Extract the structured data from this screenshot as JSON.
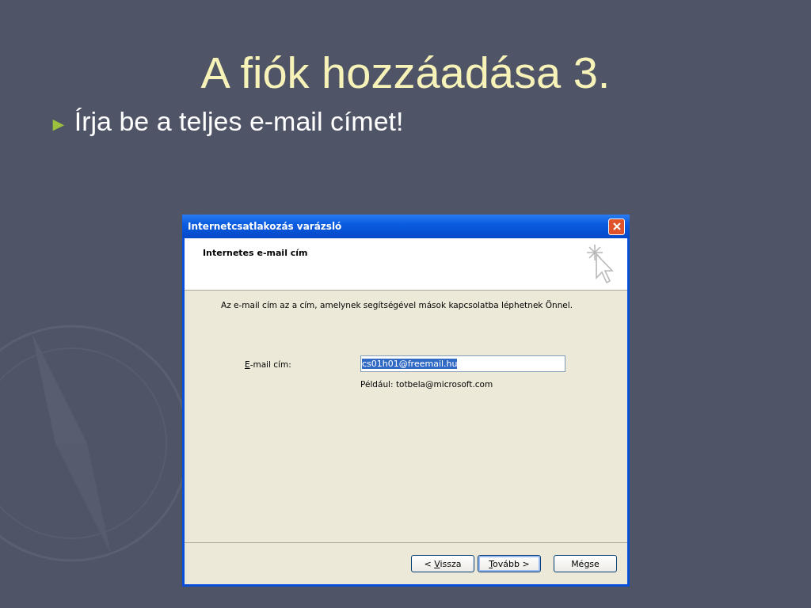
{
  "slide": {
    "title": "A fiók hozzáadása 3.",
    "bullets": [
      {
        "marker": "►",
        "text": "Írja be a teljes e-mail címet!"
      }
    ]
  },
  "dialog": {
    "title": "Internetcsatlakozás varázsló",
    "header": "Internetes e-mail cím",
    "description": "Az e-mail cím az a cím, amelynek segítségével mások kapcsolatba léphetnek Önnel.",
    "field": {
      "label": {
        "key": "E",
        "after": "-mail cím:"
      },
      "value": "cs01h01@freemail.hu",
      "value_selected": true,
      "hint": "Például: totbela@microsoft.com"
    },
    "buttons": [
      {
        "before": "< ",
        "key": "V",
        "after": "issza",
        "default": false
      },
      {
        "key": "T",
        "after": "ovább >",
        "default": true
      },
      {
        "after": "Mégse",
        "default": false
      }
    ]
  }
}
